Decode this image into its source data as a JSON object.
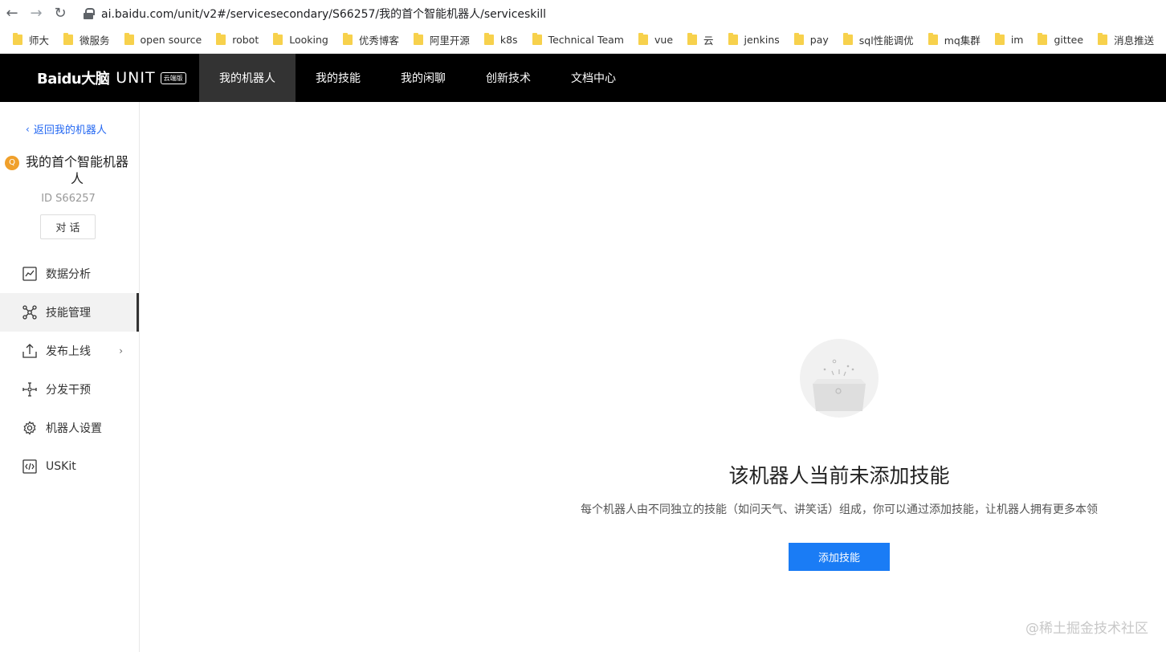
{
  "browser": {
    "url": "ai.baidu.com/unit/v2#/servicesecondary/S66257/我的首个智能机器人/serviceskill",
    "bookmarks": [
      "师大",
      "微服务",
      "open source",
      "robot",
      "Looking",
      "优秀博客",
      "阿里开源",
      "k8s",
      "Technical Team",
      "vue",
      "云",
      "jenkins",
      "pay",
      "sql性能调优",
      "mq集群",
      "im",
      "gittee",
      "消息推送"
    ]
  },
  "header": {
    "logo_text": "Baidu大脑",
    "logo_unit": "UNIT",
    "logo_badge": "云端版",
    "tabs": [
      "我的机器人",
      "我的技能",
      "我的闲聊",
      "创新技术",
      "文档中心"
    ]
  },
  "sidebar": {
    "back_label": "返回我的机器人",
    "bot_badge": "Q",
    "bot_name": "我的首个智能机器人",
    "bot_id": "ID S66257",
    "chat_label": "对 话",
    "items": [
      {
        "label": "数据分析",
        "icon": "chart-icon"
      },
      {
        "label": "技能管理",
        "icon": "skill-network-icon"
      },
      {
        "label": "发布上线",
        "icon": "upload-icon"
      },
      {
        "label": "分发干预",
        "icon": "distribute-icon"
      },
      {
        "label": "机器人设置",
        "icon": "gear-icon"
      },
      {
        "label": "USKit",
        "icon": "code-icon"
      }
    ]
  },
  "main": {
    "empty_title": "该机器人当前未添加技能",
    "empty_desc": "每个机器人由不同独立的技能（如问天气、讲笑话）组成，你可以通过添加技能，让机器人拥有更多本领",
    "add_button": "添加技能"
  },
  "watermark": "@稀土掘金技术社区",
  "colors": {
    "accent": "#1a7cf5",
    "link": "#2468f2",
    "nav_bg": "#000000",
    "badge": "#f0a02b"
  }
}
